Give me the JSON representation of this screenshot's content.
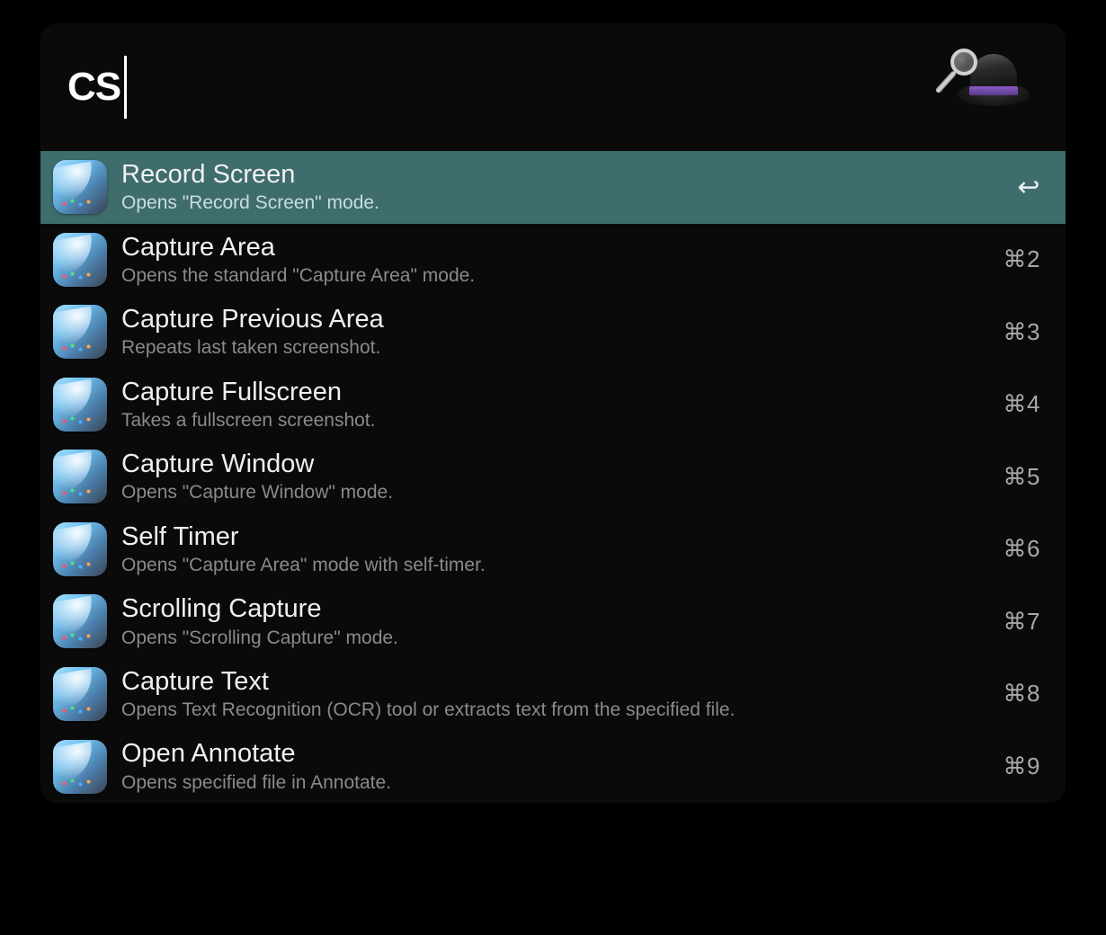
{
  "search": {
    "query": "CS"
  },
  "colors": {
    "selected_bg": "#3f6c6d",
    "panel_bg": "#0a0a0a"
  },
  "results": [
    {
      "title": "Record Screen",
      "subtitle": "Opens \"Record Screen\" mode.",
      "shortcut": "↩",
      "selected": true,
      "shortcut_is_icon": true
    },
    {
      "title": "Capture Area",
      "subtitle": "Opens the standard \"Capture Area\" mode.",
      "shortcut": "⌘2",
      "selected": false,
      "shortcut_is_icon": false
    },
    {
      "title": "Capture Previous Area",
      "subtitle": "Repeats last taken screenshot.",
      "shortcut": "⌘3",
      "selected": false,
      "shortcut_is_icon": false
    },
    {
      "title": "Capture Fullscreen",
      "subtitle": "Takes a fullscreen screenshot.",
      "shortcut": "⌘4",
      "selected": false,
      "shortcut_is_icon": false
    },
    {
      "title": "Capture Window",
      "subtitle": "Opens \"Capture Window\" mode.",
      "shortcut": "⌘5",
      "selected": false,
      "shortcut_is_icon": false
    },
    {
      "title": "Self Timer",
      "subtitle": "Opens \"Capture Area\" mode with self-timer.",
      "shortcut": "⌘6",
      "selected": false,
      "shortcut_is_icon": false
    },
    {
      "title": "Scrolling Capture",
      "subtitle": "Opens \"Scrolling Capture\" mode.",
      "shortcut": "⌘7",
      "selected": false,
      "shortcut_is_icon": false
    },
    {
      "title": "Capture Text",
      "subtitle": "Opens Text Recognition (OCR) tool or extracts text from the specified file.",
      "shortcut": "⌘8",
      "selected": false,
      "shortcut_is_icon": false
    },
    {
      "title": "Open Annotate",
      "subtitle": "Opens specified file in Annotate.",
      "shortcut": "⌘9",
      "selected": false,
      "shortcut_is_icon": false
    }
  ]
}
